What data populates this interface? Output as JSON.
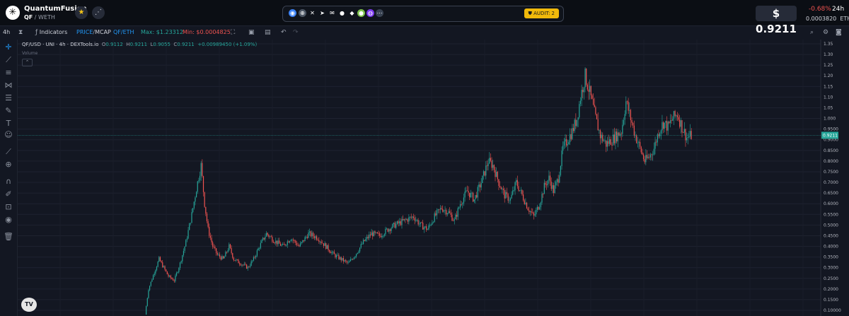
{
  "header": {
    "pair_name": "QuantumFusion",
    "base": "QF",
    "quote": "WETH",
    "logo_glyph": "✳",
    "audit_label": "AUDIT: 2",
    "price": "$ 0.9211",
    "change": "-0.68%",
    "change_period": "24h",
    "eth_price": "0.0003820",
    "eth_unit": "ETH",
    "colors": {
      "negative": "#ef5350",
      "audit": "#f0b90b",
      "positive": "#26a69a"
    }
  },
  "toolbar": {
    "timeframe": "4h",
    "indicators_label": "Indicators",
    "price_label": "PRICE",
    "mcap_label": "MCAP",
    "pair_label": "QF/ETH",
    "max_label": "Max: $1.23312",
    "min_label": "Min: $0.0004825"
  },
  "legend": {
    "title": "QF/USD · UNI · 4h · DEXTools.io",
    "o_key": "O",
    "o_val": "0.9112",
    "h_key": "H",
    "h_val": "0.9211",
    "l_key": "L",
    "l_val": "0.9055",
    "c_key": "C",
    "c_val": "0.9211",
    "change": "+0.00989450 (+1.09%)",
    "volume_label": "Volume",
    "tv_logo": "TV"
  },
  "chart_data": {
    "type": "candlestick",
    "y_ticks": [
      "1.35",
      "1.30",
      "1.25",
      "1.20",
      "1.15",
      "1.10",
      "1.05",
      "1.000",
      "0.9500",
      "0.9000",
      "0.8500",
      "0.8000",
      "0.7500",
      "0.7000",
      "0.6500",
      "0.6000",
      "0.5500",
      "0.5000",
      "0.4500",
      "0.4000",
      "0.3500",
      "0.3000",
      "0.2500",
      "0.2000",
      "0.1500",
      "0.10000"
    ],
    "ylim": [
      0.1,
      1.35
    ],
    "current_price": 0.9211,
    "current_price_label": "0.9211",
    "colors": {
      "up": "#26a69a",
      "down": "#ef5350",
      "price_line": "#26a69a"
    },
    "price_path": [
      [
        0,
        0.08
      ],
      [
        3,
        0.2
      ],
      [
        8,
        0.28
      ],
      [
        12,
        0.34
      ],
      [
        16,
        0.3
      ],
      [
        20,
        0.26
      ],
      [
        25,
        0.24
      ],
      [
        30,
        0.32
      ],
      [
        35,
        0.42
      ],
      [
        40,
        0.55
      ],
      [
        45,
        0.7
      ],
      [
        48,
        0.78
      ],
      [
        51,
        0.6
      ],
      [
        54,
        0.48
      ],
      [
        58,
        0.4
      ],
      [
        62,
        0.36
      ],
      [
        67,
        0.34
      ],
      [
        72,
        0.4
      ],
      [
        76,
        0.34
      ],
      [
        82,
        0.32
      ],
      [
        88,
        0.3
      ],
      [
        93,
        0.34
      ],
      [
        98,
        0.4
      ],
      [
        104,
        0.46
      ],
      [
        110,
        0.43
      ],
      [
        118,
        0.4
      ],
      [
        125,
        0.44
      ],
      [
        132,
        0.4
      ],
      [
        140,
        0.46
      ],
      [
        148,
        0.44
      ],
      [
        155,
        0.4
      ],
      [
        162,
        0.36
      ],
      [
        168,
        0.34
      ],
      [
        174,
        0.32
      ],
      [
        180,
        0.36
      ],
      [
        187,
        0.42
      ],
      [
        194,
        0.46
      ],
      [
        201,
        0.45
      ],
      [
        208,
        0.48
      ],
      [
        214,
        0.5
      ],
      [
        222,
        0.52
      ],
      [
        230,
        0.54
      ],
      [
        236,
        0.5
      ],
      [
        242,
        0.48
      ],
      [
        248,
        0.54
      ],
      [
        254,
        0.58
      ],
      [
        260,
        0.56
      ],
      [
        265,
        0.52
      ],
      [
        270,
        0.6
      ],
      [
        276,
        0.66
      ],
      [
        282,
        0.62
      ],
      [
        288,
        0.7
      ],
      [
        294,
        0.8
      ],
      [
        298,
        0.78
      ],
      [
        303,
        0.7
      ],
      [
        308,
        0.64
      ],
      [
        313,
        0.62
      ],
      [
        318,
        0.7
      ],
      [
        323,
        0.64
      ],
      [
        328,
        0.58
      ],
      [
        333,
        0.54
      ],
      [
        338,
        0.6
      ],
      [
        342,
        0.68
      ],
      [
        346,
        0.72
      ],
      [
        350,
        0.66
      ],
      [
        354,
        0.72
      ],
      [
        358,
        0.86
      ],
      [
        362,
        0.9
      ],
      [
        366,
        0.94
      ],
      [
        370,
        1.0
      ],
      [
        373,
        1.1
      ],
      [
        377,
        1.2
      ],
      [
        381,
        1.12
      ],
      [
        386,
        1.0
      ],
      [
        390,
        0.92
      ],
      [
        395,
        0.88
      ],
      [
        400,
        0.9
      ],
      [
        404,
        0.92
      ],
      [
        408,
        0.94
      ],
      [
        412,
        1.08
      ],
      [
        416,
        1.0
      ],
      [
        420,
        0.92
      ],
      [
        424,
        0.86
      ],
      [
        428,
        0.8
      ],
      [
        432,
        0.82
      ],
      [
        436,
        0.86
      ],
      [
        440,
        0.94
      ],
      [
        444,
        0.98
      ],
      [
        448,
        0.96
      ],
      [
        452,
        1.0
      ],
      [
        456,
        1.02
      ],
      [
        460,
        0.96
      ],
      [
        464,
        0.91
      ],
      [
        468,
        0.92
      ]
    ]
  }
}
